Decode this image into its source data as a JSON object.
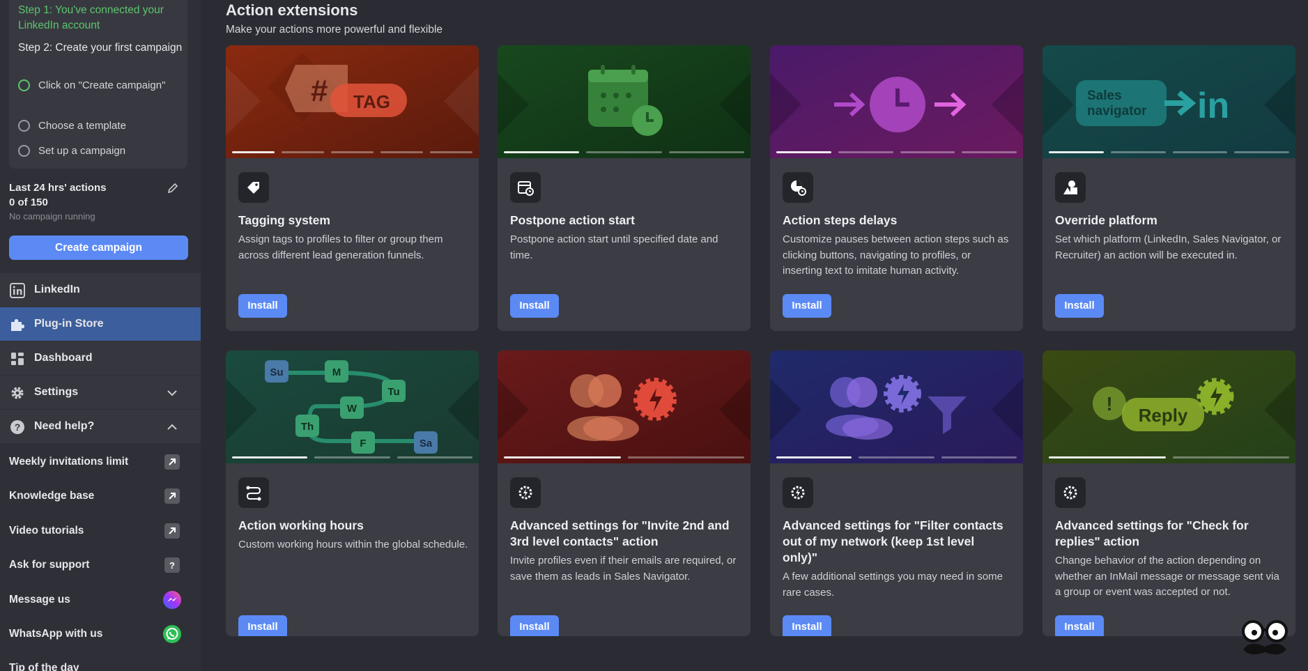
{
  "sidebar": {
    "onboarding": {
      "step1": "Step 1: You've connected your LinkedIn account",
      "step2": "Step 2: Create your first campaign",
      "substeps": [
        "Click on \"Create campaign\"",
        "Choose a template",
        "Set up a campaign"
      ]
    },
    "actions": {
      "title": "Last 24 hrs' actions",
      "count": "0 of 150",
      "status": "No campaign running"
    },
    "create_button": "Create campaign",
    "nav": {
      "linkedin": "LinkedIn",
      "plugin_store": "Plug-in Store",
      "dashboard": "Dashboard",
      "settings": "Settings",
      "need_help": "Need help?"
    },
    "help": [
      "Weekly invitations limit",
      "Knowledge base",
      "Video tutorials",
      "Ask for support",
      "Message us",
      "WhatsApp with us",
      "Tip of the day"
    ]
  },
  "main": {
    "title": "Action extensions",
    "subtitle": "Make your actions more powerful and flexible",
    "install_label": "Install",
    "cards": [
      {
        "title": "Tagging system",
        "desc": "Assign tags to profiles to filter or group them across different lead generation funnels.",
        "banner_text": "TAG",
        "color": "#7a2414"
      },
      {
        "title": "Postpone action start",
        "desc": "Postpone action start until specified date and time.",
        "color": "#1d4a22"
      },
      {
        "title": "Action steps delays",
        "desc": "Customize pauses between action steps such as clicking buttons, navigating to profiles, or inserting text to imitate human activity.",
        "color": "#5a1a6e"
      },
      {
        "title": "Override platform",
        "desc": "Set which platform (LinkedIn, Sales Navigator, or Recruiter) an action will be executed in.",
        "banner_text_a": "Sales navigator",
        "banner_text_b": "in",
        "color": "#15484a"
      },
      {
        "title": "Action working hours",
        "desc": "Custom working hours within the global schedule.",
        "days": [
          "Su",
          "M",
          "Tu",
          "W",
          "Th",
          "F",
          "Sa"
        ],
        "color": "#1a4a3a"
      },
      {
        "title": "Advanced settings for \"Invite 2nd and 3rd level contacts\" action",
        "desc": "Invite profiles even if their emails are required, or save them as leads in Sales Navigator.",
        "color": "#6e1414"
      },
      {
        "title": "Advanced settings for \"Filter contacts out of my network (keep 1st level only)\"",
        "desc": "A few additional settings you may need in some rare cases.",
        "color": "#1f2a6a"
      },
      {
        "title": "Advanced settings for \"Check for replies\" action",
        "desc": "Change behavior of the action depending on whether an InMail message or message sent via a group or event was accepted or not.",
        "banner_text": "Reply",
        "color": "#3a4a16"
      }
    ]
  }
}
